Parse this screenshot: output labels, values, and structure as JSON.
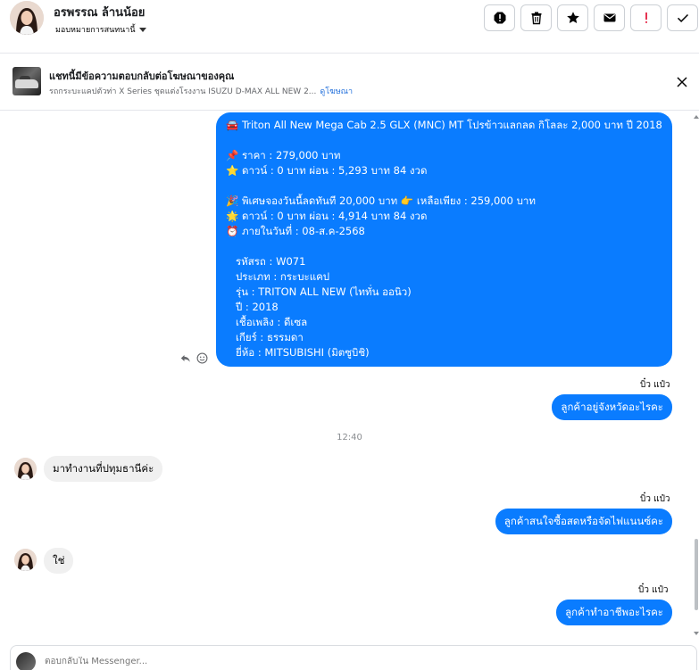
{
  "header": {
    "contact_name": "อรพรรณ ล้านน้อย",
    "assign_label": "มอบหมายการสนทนานี้",
    "actions": [
      {
        "name": "report-icon",
        "color": "#050505"
      },
      {
        "name": "trash-icon",
        "color": "#050505"
      },
      {
        "name": "star-icon",
        "color": "#050505"
      },
      {
        "name": "mail-icon",
        "color": "#050505"
      },
      {
        "name": "exclamation-icon",
        "color": "#e41e3f"
      },
      {
        "name": "check-icon",
        "color": "#050505"
      }
    ]
  },
  "ad": {
    "title": "แชทนี้มีข้อความตอบกลับต่อโฆษณาของคุณ",
    "description": "รถกระบะแคปตัวท่า X Series ชุดแต่งโรงงาน ISUZU D-MAX ALL NEW 2...",
    "link": "ดูโฆษณา"
  },
  "messages": {
    "listing": "🚘 Triton All New Mega Cab 2.5 GLX (MNC) MT โปรข้าวแลกลด กิโลละ 2,000 บาท ปี 2018\n\n📌 ราคา : 279,000 บาท\n⭐ ดาวน์ : 0 บาท ผ่อน : 5,293 บาท 84 งวด\n\n🎉 พิเศษจองวันนี้ลดทันที 20,000 บาท 👉 เหลือเพียง : 259,000 บาท\n🌟 ดาวน์ : 0 บาท ผ่อน : 4,914 บาท 84 งวด\n⏰ ภายในวันที่ : 08-ส.ค-2568\n\n   รหัสรถ : W071\n   ประเภท : กระบะแคป\n   รุ่น : TRITON ALL NEW (ไททั่น ออนิว)\n   ปี : 2018\n   เชื้อเพลิง : ดีเซล\n   เกียร์ : ธรรมดา\n   ยี่ห้อ : MITSUBISHI (มิตซูบิชิ)",
    "sender1": "บิ๋ว แป๋ว",
    "out1": "ลูกค้าอยู่จังหวัดอะไรคะ",
    "time": "12:40",
    "in1": "มาทำงานที่ปทุมธานีค่ะ",
    "sender2": "บิ๋ว แป๋ว",
    "out2": "ลูกค้าสนใจซื้อสดหรือจัดไฟแนนซ์คะ",
    "in2": "ใช่",
    "sender3": "บิ๋ว แป๋ว",
    "out3": "ลูกค้าทำอาชีพอะไรคะ"
  },
  "composer": {
    "placeholder": "ตอบกลับใน Messenger..."
  },
  "colors": {
    "accent": "#0a7cff",
    "incoming": "#f0f0f0"
  }
}
